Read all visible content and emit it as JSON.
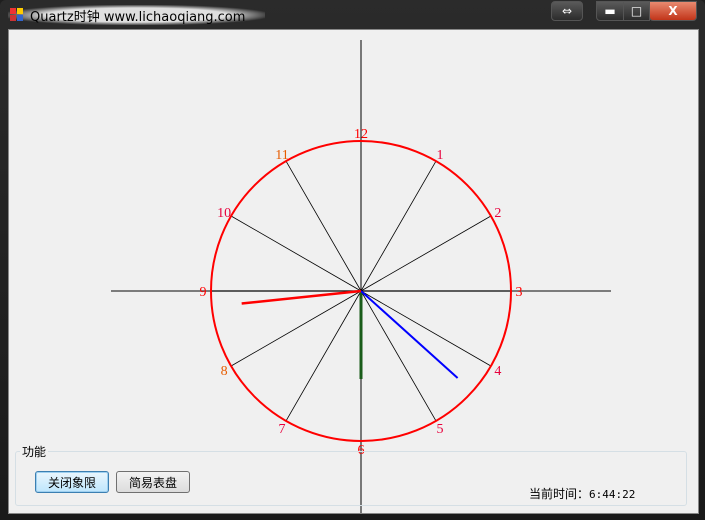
{
  "window": {
    "title": "Quartz时钟 www.lichaoqiang.com",
    "buttons": {
      "swap": "⇔",
      "minimize": "▬",
      "maximize": "□",
      "close": "X"
    }
  },
  "clock": {
    "numbers": [
      {
        "label": "12",
        "color": "#ff0000"
      },
      {
        "label": "1",
        "color": "#e8003c"
      },
      {
        "label": "2",
        "color": "#e8003c"
      },
      {
        "label": "3",
        "color": "#ff0000"
      },
      {
        "label": "4",
        "color": "#e8003c"
      },
      {
        "label": "5",
        "color": "#e8003c"
      },
      {
        "label": "6",
        "color": "#ff0000"
      },
      {
        "label": "7",
        "color": "#e8003c"
      },
      {
        "label": "8",
        "color": "#e65c00"
      },
      {
        "label": "9",
        "color": "#ff0000"
      },
      {
        "label": "10",
        "color": "#e8003c"
      },
      {
        "label": "11",
        "color": "#e65c00"
      }
    ],
    "hands": {
      "hour_angle_deg": 180,
      "minute_angle_deg": 132,
      "second_angle_deg": 264
    },
    "colors": {
      "face": "#ff0000",
      "hour": "#1a5c1a",
      "minute": "#0000ff",
      "second": "#ff0000"
    }
  },
  "panel": {
    "group_label": "功能",
    "btn_close_quadrant": "关闭象限",
    "btn_simple_dial": "简易表盘",
    "time_label": "当前时间：",
    "time_value": "6:44:22"
  }
}
